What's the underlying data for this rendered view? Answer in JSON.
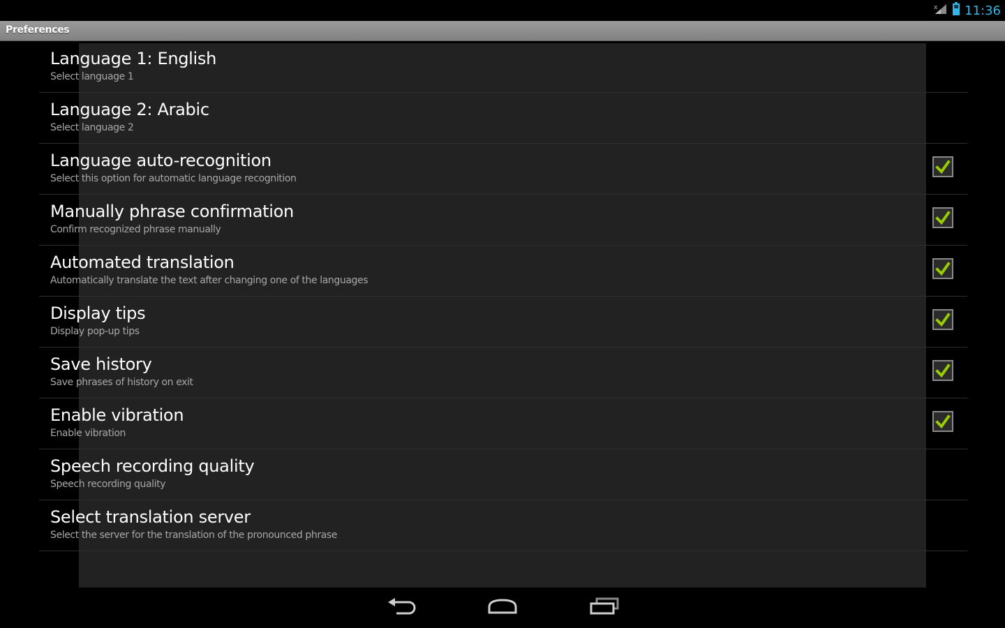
{
  "status_bar": {
    "time": "11:36",
    "icons": [
      "signal-icon",
      "battery-icon"
    ]
  },
  "title_bar": {
    "title": "Preferences"
  },
  "preferences": [
    {
      "title": "Language 1: English",
      "summary": "Select language 1",
      "checkbox": null
    },
    {
      "title": "Language 2: Arabic",
      "summary": "Select language 2",
      "checkbox": null
    },
    {
      "title": "Language auto-recognition",
      "summary": "Select this option for automatic language recognition",
      "checkbox": true
    },
    {
      "title": "Manually phrase confirmation",
      "summary": "Confirm recognized phrase manually",
      "checkbox": true
    },
    {
      "title": "Automated translation",
      "summary": "Automatically translate the text after changing one of the languages",
      "checkbox": true
    },
    {
      "title": "Display tips",
      "summary": "Display pop-up tips",
      "checkbox": true
    },
    {
      "title": "Save history",
      "summary": "Save phrases of history on exit",
      "checkbox": true
    },
    {
      "title": "Enable vibration",
      "summary": "Enable vibration",
      "checkbox": true
    },
    {
      "title": "Speech recording quality",
      "summary": "Speech recording quality",
      "checkbox": null
    },
    {
      "title": "Select translation server",
      "summary": "Select the server for the translation of the pronounced phrase",
      "checkbox": null
    }
  ],
  "nav_bar": {
    "buttons": [
      "back-icon",
      "home-icon",
      "recent-apps-icon"
    ]
  },
  "colors": {
    "accent": "#33b5e5",
    "check": "#99cc00",
    "panel": "#222222",
    "background": "#000000"
  }
}
